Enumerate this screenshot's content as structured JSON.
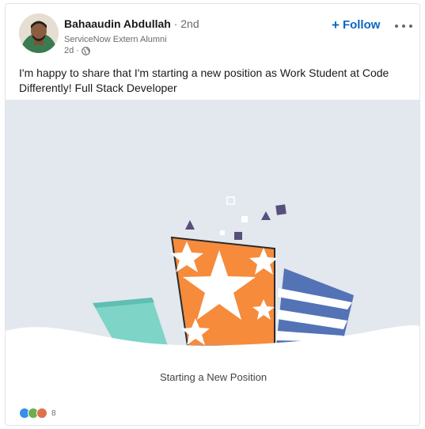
{
  "author": {
    "name": "Bahaaudin Abdullah",
    "degree": "· 2nd",
    "headline": "ServiceNow Extern Alumni",
    "time": "2d ·"
  },
  "actions": {
    "follow_label": "Follow"
  },
  "post": {
    "text": "I'm happy to share that I'm starting a new position as Work Student at Code Differently! Full Stack Developer"
  },
  "media": {
    "caption": "Starting a New Position"
  },
  "social": {
    "reaction_count": "8"
  },
  "colors": {
    "accent": "#0a66c2",
    "gift_orange": "#f68b3c",
    "gift_blue": "#5473b6",
    "gift_teal": "#7ed4c7",
    "confetti_purple": "#56507a",
    "media_background": "#e3e7ee"
  }
}
